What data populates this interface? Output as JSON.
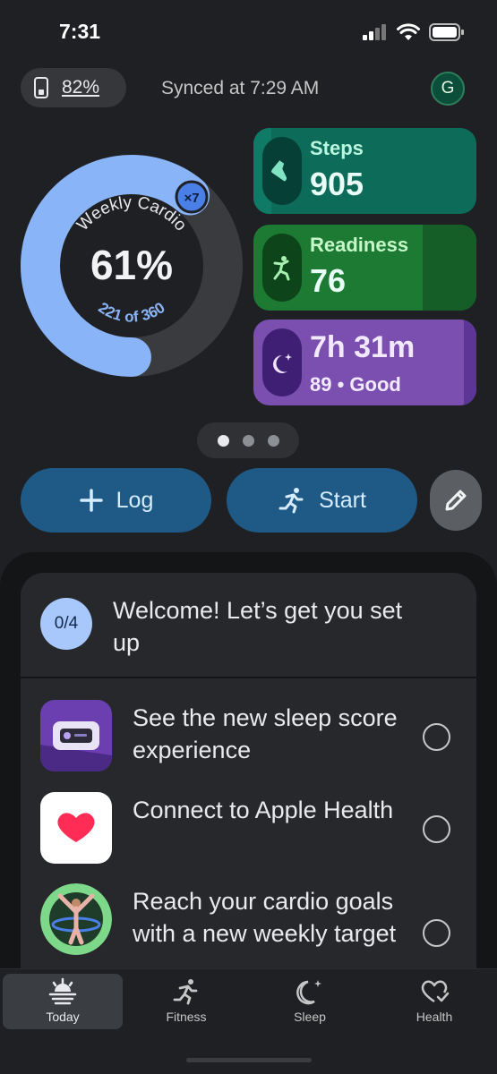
{
  "status_bar": {
    "time": "7:31"
  },
  "header": {
    "device_battery": "82%",
    "sync_status": "Synced at 7:29 AM",
    "avatar_initial": "G"
  },
  "weekly_cardio": {
    "title": "Weekly Cardio",
    "percent_label": "61%",
    "progress_label": "221 of 360",
    "progress_fraction": 0.61,
    "badge": "×7"
  },
  "tiles": {
    "steps": {
      "label": "Steps",
      "value": "905"
    },
    "readiness": {
      "label": "Readiness",
      "value": "76"
    },
    "sleep": {
      "duration": "7h 31m",
      "score": "89 • Good"
    }
  },
  "pager": {
    "pages": 3,
    "active_index": 0
  },
  "actions": {
    "log_label": "Log",
    "start_label": "Start",
    "edit_icon": "pencil-icon"
  },
  "setup_card": {
    "progress": "0/4",
    "title": "Welcome! Let’s get you set up",
    "tasks": [
      {
        "text": "See the new sleep score experience",
        "icon": "sleep-score-thumbnail"
      },
      {
        "text": "Connect to Apple Health",
        "icon": "apple-health-icon"
      },
      {
        "text": "Reach your cardio goals with a new weekly target",
        "icon": "cardio-goal-thumbnail"
      }
    ]
  },
  "nav": [
    {
      "label": "Today",
      "icon": "sunrise-icon",
      "active": true
    },
    {
      "label": "Fitness",
      "icon": "runner-icon",
      "active": false
    },
    {
      "label": "Sleep",
      "icon": "moon-icon",
      "active": false
    },
    {
      "label": "Health",
      "icon": "heart-check-icon",
      "active": false
    }
  ],
  "colors": {
    "background": "#1f2023",
    "ring_progress": "#8ab4f8",
    "steps_tile": "#0d6b5a",
    "readiness_tile": "#1c7a33",
    "sleep_tile": "#7a4fb0",
    "action_button": "#1f5a87"
  }
}
